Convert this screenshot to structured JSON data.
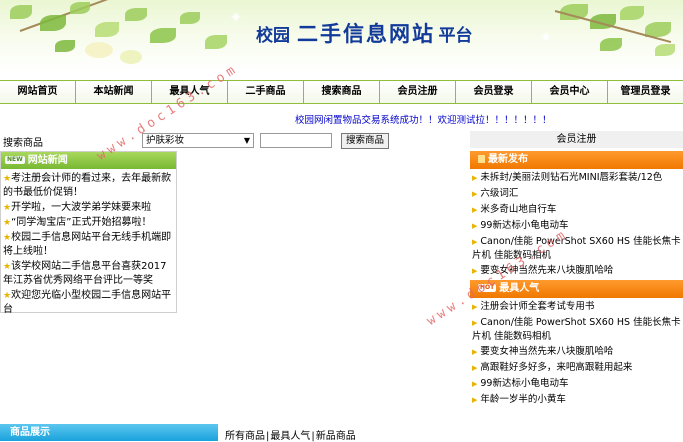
{
  "banner": {
    "title_small_1": "校园",
    "title_large": "二手信息网站",
    "title_small_2": "平台"
  },
  "nav": [
    "网站首页",
    "本站新闻",
    "最具人气",
    "二手商品",
    "搜索商品",
    "会员注册",
    "会员登录",
    "会员中心",
    "管理员登录"
  ],
  "marquee": "校园网闲置物品交易系统成功！！欢迎测试拉！！！！！！！",
  "search": {
    "label": "搜索商品",
    "selected": "护肤彩妆",
    "button": "搜索商品"
  },
  "register_label": "会员注册",
  "news": {
    "badge": "NEW",
    "title": "网站新闻",
    "items": [
      "考注册会计师的看过来，去年最新款的书最低价促销！",
      "开学啦，一大波学弟学妹要来啦",
      "“同学淘宝店”正式开始招募啦！",
      "校园二手信息网站平台无线手机端即将上线啦！",
      "该学校网站二手信息平台喜获2017年江苏省优秀网络平台评比一等奖",
      "欢迎您光临小型校园二手信息网站平台"
    ]
  },
  "latest": {
    "title": "最新发布",
    "items": [
      "未拆封/美丽法则钻石光MINI唇彩套装/12色",
      "六级词汇",
      "米多奇山地自行车",
      "99新达标小龟电动车",
      "Canon/佳能 PowerShot SX60 HS 佳能长焦卡片机 佳能数码相机",
      "要变女神当然先来八块腹肌哈哈"
    ]
  },
  "popular": {
    "badge": "HOT",
    "title": "最具人气",
    "items": [
      "注册会计师全套考试专用书",
      "Canon/佳能 PowerShot SX60 HS 佳能长焦卡片机 佳能数码相机",
      "要变女神当然先来八块腹肌哈哈",
      "高跟鞋好多好多，来吧高跟鞋用起来",
      "99新达标小龟电动车",
      "年龄一岁半的小黄车"
    ]
  },
  "bottom": {
    "title": "商品展示",
    "tabs": [
      "所有商品",
      "最具人气",
      "新品商品"
    ]
  },
  "watermark": "www.doc163.com"
}
